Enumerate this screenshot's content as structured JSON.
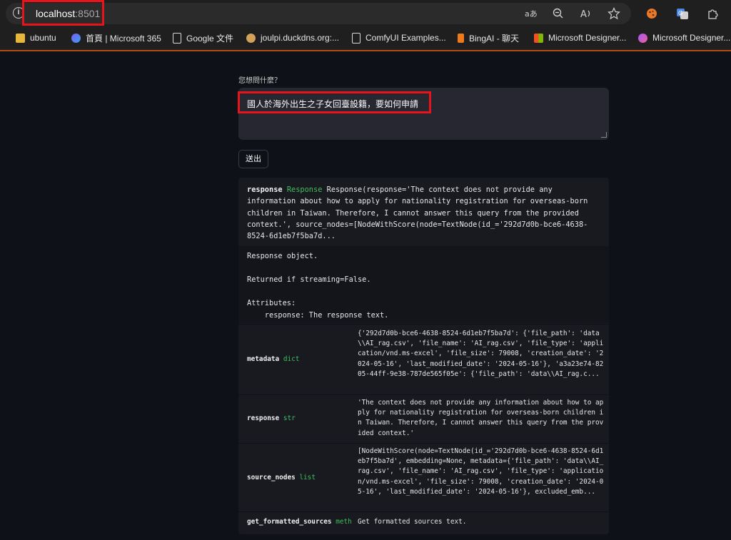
{
  "browser": {
    "url_host": "localhost",
    "url_port": ":8501",
    "toolbar_icons": [
      "read-aloud-translate-icon",
      "zoom-out-icon",
      "read-aloud-icon",
      "favorite-star-icon",
      "extension-cookie-icon",
      "translate-icon",
      "extensions-puzzle-icon"
    ],
    "bookmarks": [
      {
        "label": "ubuntu",
        "icon": "folder-icon"
      },
      {
        "label": "首頁 | Microsoft 365",
        "icon": "m365-icon"
      },
      {
        "label": "Google 文件",
        "icon": "document-icon"
      },
      {
        "label": "joulpi.duckdns.org:...",
        "icon": "site-icon"
      },
      {
        "label": "ComfyUI Examples...",
        "icon": "document-icon"
      },
      {
        "label": "BingAI - 聊天",
        "icon": "bing-icon"
      },
      {
        "label": "Microsoft Designer...",
        "icon": "microsoft-icon"
      },
      {
        "label": "Microsoft Designer...",
        "icon": "designer-icon"
      }
    ],
    "accent_color": "#b44a16",
    "highlight_color": "#e8141b"
  },
  "form": {
    "question_label": "您想問什麼？",
    "question_value": "國人於海外出生之子女回臺設籍，要如何申請",
    "send_label": "送出"
  },
  "response": {
    "name": "response",
    "type": "Response",
    "repr": "Response(response='The context does not provide any information about how to apply for nationality registration for overseas-born children in Taiwan. Therefore, I cannot answer this query from the provided context.', source_nodes=[NodeWithScore(node=TextNode(id_='292d7d0b-bce6-4638-8524-6d1eb7f5ba7d...",
    "doc": "Response object.\n\nReturned if streaming=False.\n\nAttributes:\n    response: The response text.",
    "attributes": [
      {
        "name": "metadata",
        "type": "dict",
        "value": "{'292d7d0b-bce6-4638-8524-6d1eb7f5ba7d': {'file_path': 'data\\\\AI_rag.csv', 'file_name': 'AI_rag.csv', 'file_type': 'application/vnd.ms-excel', 'file_size': 79008, 'creation_date': '2024-05-16', 'last_modified_date': '2024-05-16'}, 'a3a23e74-8205-44ff-9e38-787de565f05e': {'file_path': 'data\\\\AI_rag.c..."
      },
      {
        "name": "response",
        "type": "str",
        "value": "'The context does not provide any information about how to apply for nationality registration for overseas-born children in Taiwan. Therefore, I cannot answer this query from the provided context.'"
      },
      {
        "name": "source_nodes",
        "type": "list",
        "value": "[NodeWithScore(node=TextNode(id_='292d7d0b-bce6-4638-8524-6d1eb7f5ba7d', embedding=None, metadata={'file_path': 'data\\\\AI_rag.csv', 'file_name': 'AI_rag.csv', 'file_type': 'application/vnd.ms-excel', 'file_size': 79008, 'creation_date': '2024-05-16', 'last_modified_date': '2024-05-16'}, excluded_emb..."
      },
      {
        "name": "get_formatted_sources",
        "type": "meth",
        "value": "Get formatted sources text."
      }
    ]
  }
}
